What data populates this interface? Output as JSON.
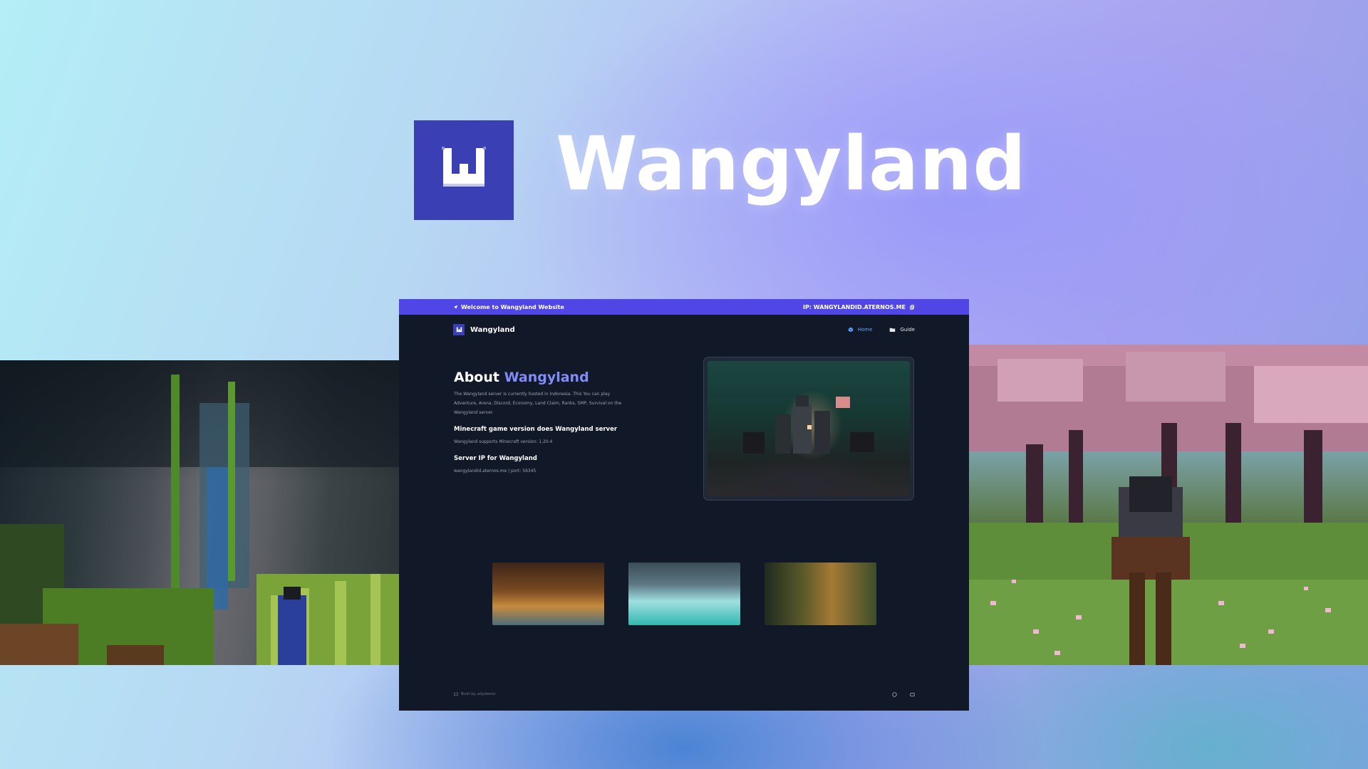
{
  "hero": {
    "title": "Wangyland"
  },
  "site": {
    "banner": {
      "welcome": "Welcome to Wangyland Website",
      "ip": "IP: WANGYLANDID.ATERNOS.ME"
    },
    "nav": {
      "brand": "Wangyland",
      "links": [
        {
          "label": "Home",
          "icon": "cube-icon",
          "active": true
        },
        {
          "label": "Guide",
          "icon": "folder-icon",
          "active": false
        }
      ]
    },
    "about": {
      "title_prefix": "About",
      "title_accent": "Wangyland",
      "description": "The Wangyland server is currently hosted in Indonesia. This You can play Adventure, Arena, Discord, Economy, Land Claim, Ranks, SMP, Survival on the Wangyland server.",
      "version_heading": "Minecraft game version does Wangyland server",
      "version_text": "Wangyland supports Minecraft version: 1.20.4",
      "ip_heading": "Server IP for Wangyland",
      "ip_text": "wangylandid.aternos.me | port: 56345"
    },
    "footer": {
      "credit": "Built by adydemo"
    }
  },
  "colors": {
    "accent": "#4f46e5",
    "accent_text": "#818cf8",
    "logo_bg": "#3a3fb4",
    "site_bg": "#111827",
    "active_link": "#60a5fa"
  }
}
